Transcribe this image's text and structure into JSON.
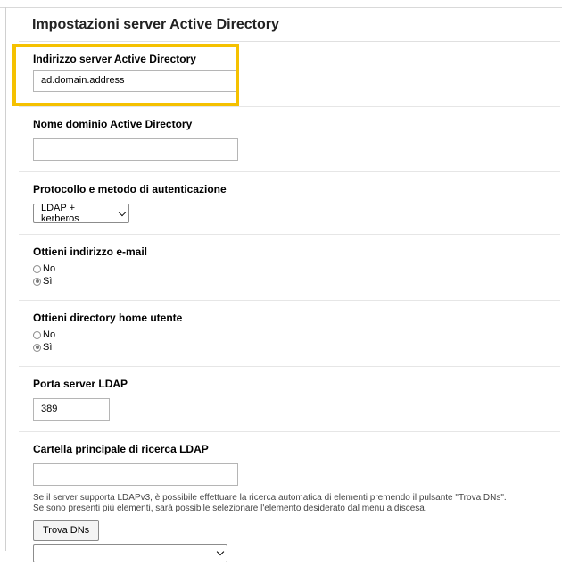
{
  "page": {
    "title": "Impostazioni server Active Directory"
  },
  "ad_server_address": {
    "label": "Indirizzo server Active Directory",
    "value": "ad.domain.address"
  },
  "ad_domain_name": {
    "label": "Nome dominio Active Directory",
    "value": ""
  },
  "auth_protocol": {
    "label": "Protocollo e metodo di autenticazione",
    "selected": "LDAP + kerberos"
  },
  "get_email": {
    "label": "Ottieni indirizzo e-mail",
    "options": [
      "No",
      "Sì"
    ],
    "selected": "Sì"
  },
  "get_home_dir": {
    "label": "Ottieni directory home utente",
    "options": [
      "No",
      "Sì"
    ],
    "selected": "Sì"
  },
  "ldap_port": {
    "label": "Porta server LDAP",
    "value": "389"
  },
  "ldap_search_root": {
    "label": "Cartella principale di ricerca LDAP",
    "value": "",
    "help_line1": "Se il server supporta LDAPv3, è possibile effettuare la ricerca automatica di elementi premendo il pulsante \"Trova DNs\".",
    "help_line2": "Se sono presenti più elementi, sarà possibile selezionare l'elemento desiderato dal menu a discesa.",
    "find_button": "Trova DNs",
    "dn_select": ""
  },
  "colors": {
    "highlight": "#f5c100"
  }
}
